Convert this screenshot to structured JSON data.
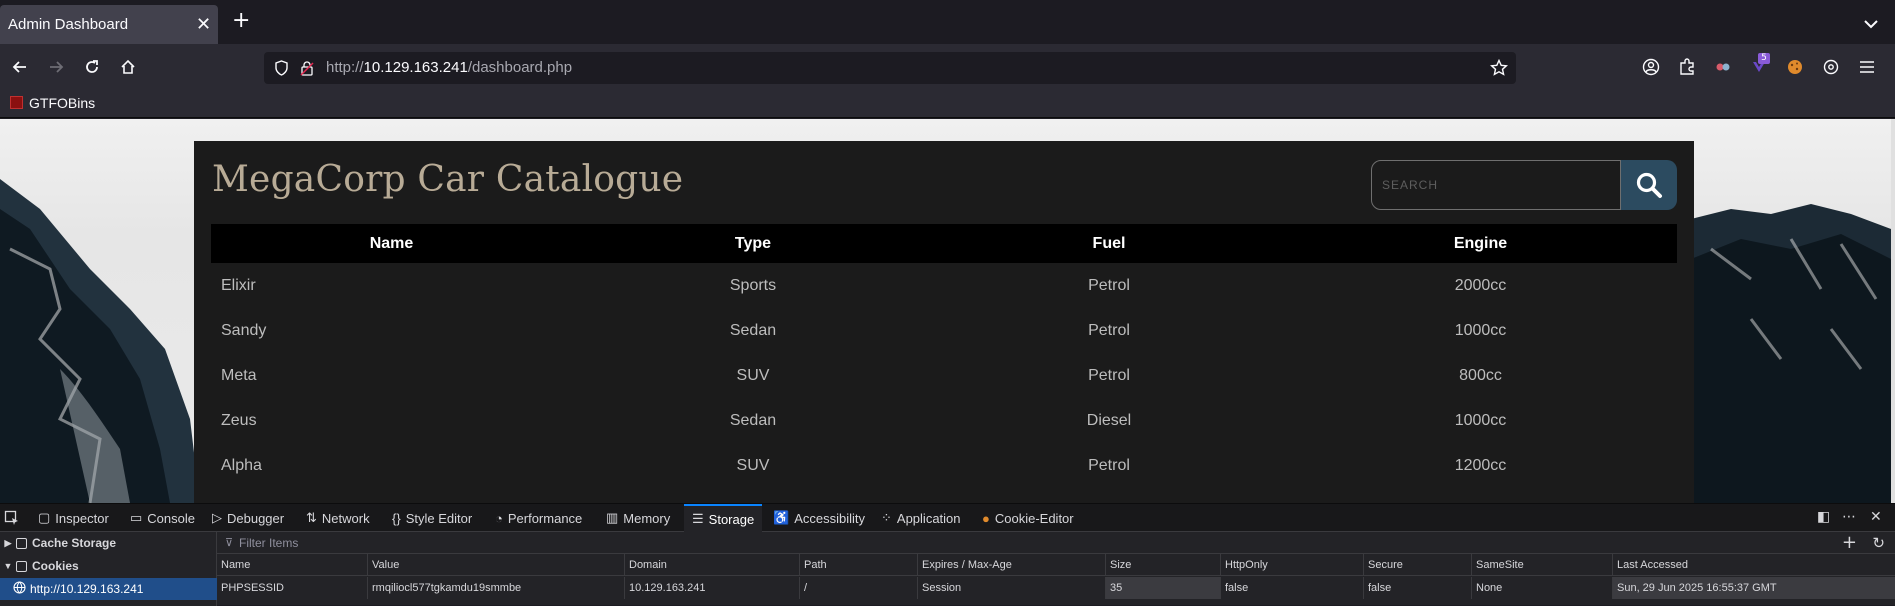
{
  "browser": {
    "tab_title": "Admin Dashboard",
    "url_prefix": "http://",
    "url_host": "10.129.163.241",
    "url_path": "/dashboard.php",
    "extension_badge": "5",
    "bookmark_label": "GTFOBins"
  },
  "page": {
    "title": "MegaCorp Car Catalogue",
    "search_placeholder": "SEARCH",
    "table": {
      "headers": [
        "Name",
        "Type",
        "Fuel",
        "Engine"
      ],
      "rows": [
        [
          "Elixir",
          "Sports",
          "Petrol",
          "2000cc"
        ],
        [
          "Sandy",
          "Sedan",
          "Petrol",
          "1000cc"
        ],
        [
          "Meta",
          "SUV",
          "Petrol",
          "800cc"
        ],
        [
          "Zeus",
          "Sedan",
          "Diesel",
          "1000cc"
        ],
        [
          "Alpha",
          "SUV",
          "Petrol",
          "1200cc"
        ]
      ]
    }
  },
  "devtools": {
    "tabs": [
      "Inspector",
      "Console",
      "Debugger",
      "Network",
      "Style Editor",
      "Performance",
      "Memory",
      "Storage",
      "Accessibility",
      "Application",
      "Cookie-Editor"
    ],
    "active_tab": "Storage",
    "sidebar": {
      "cache_storage": "Cache Storage",
      "cookies": "Cookies",
      "cookie_host": "http://10.129.163.241"
    },
    "filter_placeholder": "Filter Items",
    "columns": [
      "Name",
      "Value",
      "Domain",
      "Path",
      "Expires / Max-Age",
      "Size",
      "HttpOnly",
      "Secure",
      "SameSite",
      "Last Accessed"
    ],
    "cookie": [
      "PHPSESSID",
      "rmqiliocl577tgkamdu19smmbe",
      "10.129.163.241",
      "/",
      "Session",
      "35",
      "false",
      "false",
      "None",
      "Sun, 29 Jun 2025 16:55:37 GMT"
    ]
  }
}
